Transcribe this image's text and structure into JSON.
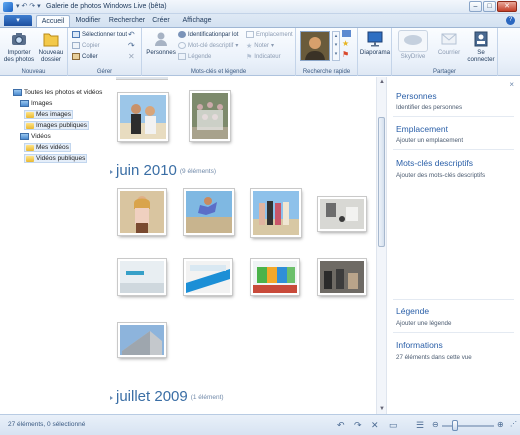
{
  "window": {
    "title": "Galerie de photos Windows Live (bêta)",
    "quick_access": "▾ ↶ ↷ ▾",
    "controls": {
      "minimize": "–",
      "maximize": "□",
      "close": "✕"
    }
  },
  "tabs": {
    "file_label": "▾",
    "items": [
      "Accueil",
      "Modifier",
      "Rechercher",
      "Créer",
      "Affichage"
    ],
    "active": "Accueil",
    "help": "?"
  },
  "ribbon": {
    "nouveau": {
      "label": "Nouveau",
      "import_label": "Importer des photos",
      "new_folder_label": "Nouveau dossier"
    },
    "gerer": {
      "label": "Gérer",
      "select_all": "Sélectionner tout",
      "copy": "Copier",
      "paste": "Coller"
    },
    "mots_cles": {
      "label": "Mots-clés et légende",
      "people": "Personnes",
      "identify_batch": "Identificationpar lot",
      "descriptive_tag": "Mot-clé descriptif",
      "caption": "Légende",
      "location": "Emplacement",
      "rate": "Noter",
      "flag": "Indicateur"
    },
    "recherche_rapide": {
      "label": "Recherche rapide"
    },
    "diaporama": {
      "label": "Diaporama"
    },
    "partager": {
      "label": "Partager",
      "skydrive": "SkyDrive",
      "email": "Courrier",
      "signin": "Se connecter"
    }
  },
  "nav": {
    "items": [
      {
        "label": "Toutes les photos et vidéos",
        "level": 0
      },
      {
        "label": "Images",
        "level": 1
      },
      {
        "label": "Mes images",
        "level": 2
      },
      {
        "label": "Images publiques",
        "level": 2
      },
      {
        "label": "Vidéos",
        "level": 1
      },
      {
        "label": "Mes vidéos",
        "level": 2
      },
      {
        "label": "Vidéos publiques",
        "level": 2
      }
    ]
  },
  "gallery": {
    "groups": [
      {
        "title": "juin 2010",
        "count": "(9 éléments)"
      },
      {
        "title": "juillet 2009",
        "count": "(1 élément)"
      }
    ]
  },
  "info_pane": {
    "close": "×",
    "sections": [
      {
        "title": "Personnes",
        "subtitle": "Identifier des personnes"
      },
      {
        "title": "Emplacement",
        "subtitle": "Ajouter un emplacement"
      },
      {
        "title": "Mots-clés descriptifs",
        "subtitle": "Ajouter des mots-clés descriptifs"
      },
      {
        "title": "Légende",
        "subtitle": "Ajouter une légende"
      },
      {
        "title": "Informations",
        "subtitle": "27 éléments dans cette vue"
      }
    ]
  },
  "status": {
    "text": "27 éléments, 0 sélectionné",
    "zoom_fraction": 0.25
  },
  "colors": {
    "accent": "#2a5fa8",
    "ribbon_bg": "#eaf1fa",
    "file_button": "#1c4fa0"
  }
}
